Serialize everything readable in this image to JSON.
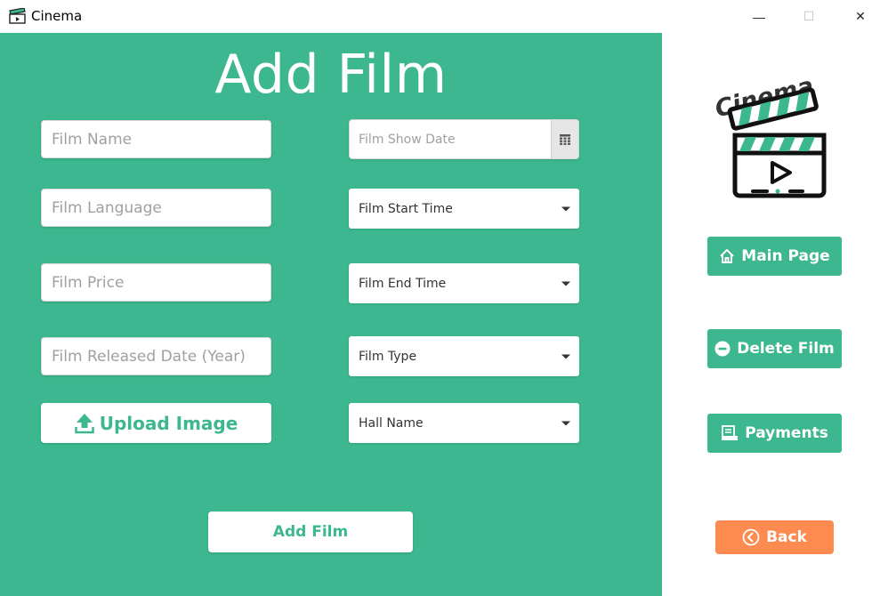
{
  "window": {
    "title": "Cinema",
    "controls": {
      "minimize": "—",
      "maximize": "☐",
      "close": "✕"
    }
  },
  "form": {
    "heading": "Add Film",
    "film_name_placeholder": "Film Name",
    "film_language_placeholder": "Film Language",
    "film_price_placeholder": "Film Price",
    "film_released_placeholder": "Film Released Date (Year)",
    "upload_label": "Upload Image",
    "show_date_placeholder": "Film Show Date",
    "start_time_label": "Film Start Time",
    "end_time_label": "Film End Time",
    "type_label": "Film Type",
    "hall_label": "Hall Name",
    "submit_label": "Add Film"
  },
  "sidebar": {
    "logo_text": "Cinema",
    "main_page_label": "Main Page",
    "delete_film_label": "Delete Film",
    "payments_label": "Payments",
    "back_label": "Back"
  },
  "colors": {
    "panel": "#3cb78f",
    "back": "#fd8a4f",
    "text_on_panel": "#ffffff"
  },
  "icons": {
    "app": "clapperboard-icon",
    "calendar": "calendar-icon",
    "upload": "upload-icon",
    "home": "home-icon",
    "delete": "minus-circle-icon",
    "payments": "receipt-icon",
    "back": "back-arrow-circle-icon"
  }
}
